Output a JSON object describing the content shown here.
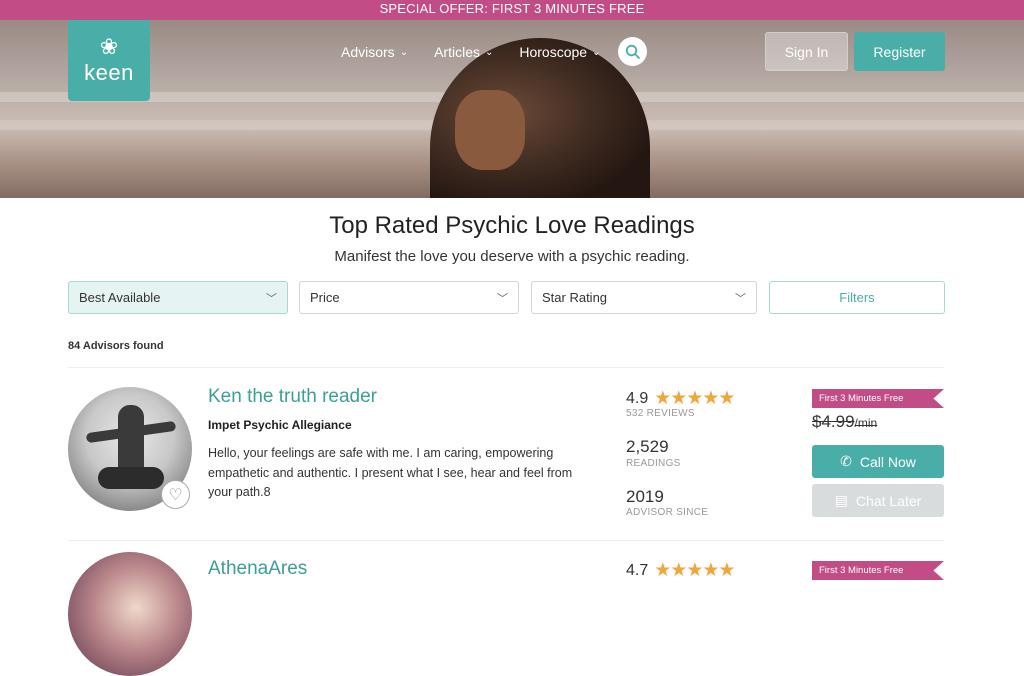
{
  "promo": {
    "text": "SPECIAL OFFER: FIRST 3 MINUTES FREE"
  },
  "logo": {
    "text": "keen"
  },
  "nav": {
    "items": [
      {
        "label": "Advisors"
      },
      {
        "label": "Articles"
      },
      {
        "label": "Horoscope"
      }
    ]
  },
  "auth": {
    "signin": "Sign In",
    "register": "Register"
  },
  "page": {
    "title": "Top Rated Psychic Love Readings",
    "subtitle": "Manifest the love you deserve with a psychic reading."
  },
  "filters": {
    "sort": "Best Available",
    "price": "Price",
    "rating": "Star Rating",
    "more": "Filters"
  },
  "results": {
    "count_text": "84 Advisors found"
  },
  "advisors": [
    {
      "name": "Ken the truth reader",
      "guild": "Impet Psychic Allegiance",
      "bio": "Hello, your feelings are safe with me. I am caring, empowering empathetic and authentic. I present what I see, hear and feel from your path.8",
      "rating": "4.9",
      "reviews": "532 REVIEWS",
      "readings": "2,529",
      "readings_label": "READINGS",
      "since": "2019",
      "since_label": "ADVISOR SINCE",
      "promo": "First 3 Minutes Free",
      "price": "$4.99",
      "price_unit": "/min",
      "call_label": "Call Now",
      "chat_label": "Chat Later"
    },
    {
      "name": "AthenaAres",
      "rating": "4.7",
      "promo": "First 3 Minutes Free"
    }
  ],
  "colors": {
    "accent": "#4aaea8",
    "promo": "#c24c86",
    "star": "#f0a63a"
  }
}
